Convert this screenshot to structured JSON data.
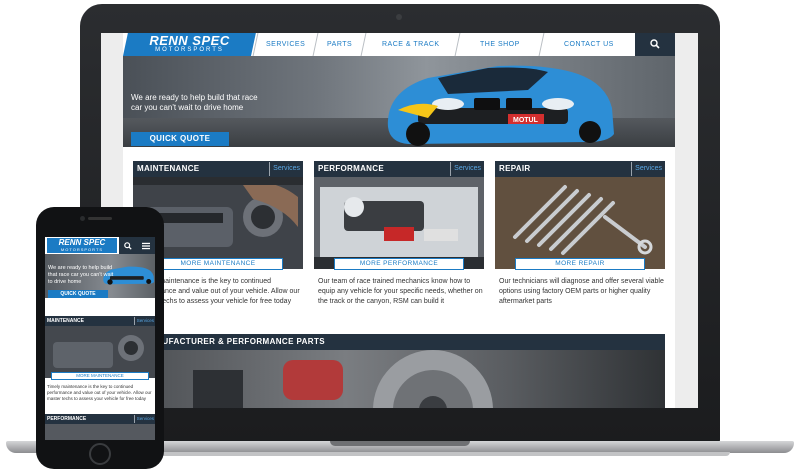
{
  "site": {
    "logo": {
      "main": "RENN SPEC",
      "sub": "MOTORSPORTS"
    },
    "nav": [
      {
        "label": "SERVICES",
        "w": 60
      },
      {
        "label": "PARTS",
        "w": 48
      },
      {
        "label": "RACE & TRACK",
        "w": 94
      },
      {
        "label": "THE SHOP",
        "w": 84
      },
      {
        "label": "CONTACT US",
        "w": 94
      }
    ],
    "search_icon": "search-icon",
    "hero": {
      "text": "We are ready to help build that race car you can't wait to drive home",
      "button": "QUICK QUOTE"
    },
    "cards": [
      {
        "title": "MAINTENANCE",
        "tag": "Services",
        "button": "MORE MAINTENANCE",
        "text": "Timely maintenance is the key to continued performance and value out of your vehicle. Allow our master techs to assess your vehicle for free today"
      },
      {
        "title": "PERFORMANCE",
        "tag": "Services",
        "button": "MORE PERFORMANCE",
        "text": "Our team of race trained mechanics know how to equip any vehicle for your specific needs, whether on the track or the canyon, RSM can build it"
      },
      {
        "title": "REPAIR",
        "tag": "Services",
        "button": "MORE REPAIR",
        "text": "Our technicians will diagnose and offer several viable options using factory OEM parts or higher quality aftermarket parts"
      }
    ],
    "parts_bar": "MANUFACTURER & PERFORMANCE PARTS"
  },
  "mobile": {
    "logo": {
      "main": "RENN SPEC",
      "sub": "MOTORSPORTS"
    },
    "icons": [
      "search-icon",
      "menu-icon"
    ],
    "hero": {
      "text": "We are ready to help build that race car you can't wait to drive home",
      "button": "QUICK QUOTE"
    },
    "card1": {
      "title": "MAINTENANCE",
      "tag": "Services",
      "button": "MORE MAINTENANCE",
      "text": "Timely maintenance is the key to continued performance and value out of your vehicle. Allow our master techs to assess your vehicle for free today"
    },
    "card2": {
      "title": "PERFORMANCE",
      "tag": "Services"
    }
  },
  "colors": {
    "brand_blue": "#1b7bc4",
    "dark_bar": "#243240",
    "tag_blue": "#59a6e2"
  }
}
